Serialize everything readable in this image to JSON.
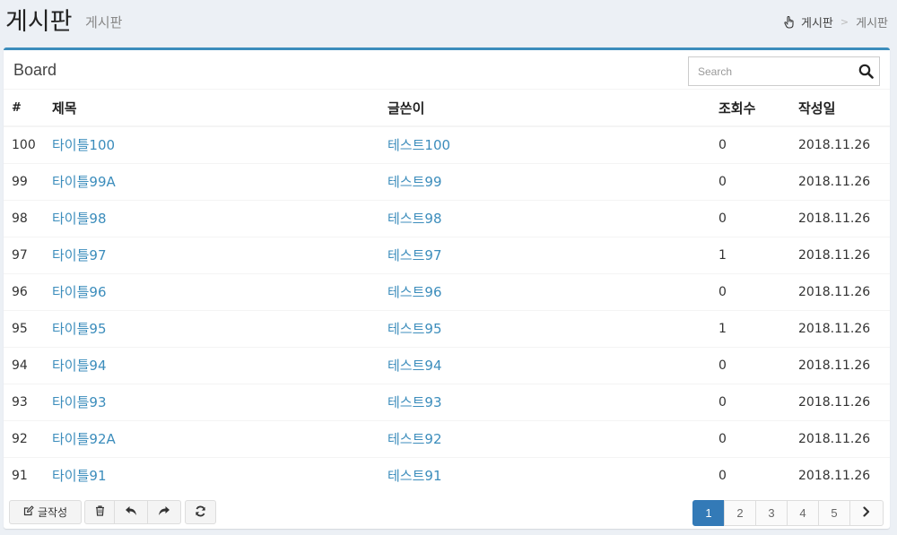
{
  "header": {
    "title": "게시판",
    "subtitle": "게시판",
    "breadcrumb": [
      "게시판",
      "게시판"
    ],
    "breadcrumb_separator": ">"
  },
  "box": {
    "title": "Board",
    "search_placeholder": "Search"
  },
  "table": {
    "headers": {
      "num": "#",
      "title": "제목",
      "writer": "글쓴이",
      "views": "조회수",
      "date": "작성일"
    },
    "rows": [
      {
        "num": "100",
        "title": "타이틀100",
        "writer": "테스트100",
        "views": "0",
        "date": "2018.11.26"
      },
      {
        "num": "99",
        "title": "타이틀99A",
        "writer": "테스트99",
        "views": "0",
        "date": "2018.11.26"
      },
      {
        "num": "98",
        "title": "타이틀98",
        "writer": "테스트98",
        "views": "0",
        "date": "2018.11.26"
      },
      {
        "num": "97",
        "title": "타이틀97",
        "writer": "테스트97",
        "views": "1",
        "date": "2018.11.26"
      },
      {
        "num": "96",
        "title": "타이틀96",
        "writer": "테스트96",
        "views": "0",
        "date": "2018.11.26"
      },
      {
        "num": "95",
        "title": "타이틀95",
        "writer": "테스트95",
        "views": "1",
        "date": "2018.11.26"
      },
      {
        "num": "94",
        "title": "타이틀94",
        "writer": "테스트94",
        "views": "0",
        "date": "2018.11.26"
      },
      {
        "num": "93",
        "title": "타이틀93",
        "writer": "테스트93",
        "views": "0",
        "date": "2018.11.26"
      },
      {
        "num": "92",
        "title": "타이틀92A",
        "writer": "테스트92",
        "views": "0",
        "date": "2018.11.26"
      },
      {
        "num": "91",
        "title": "타이틀91",
        "writer": "테스트91",
        "views": "0",
        "date": "2018.11.26"
      }
    ]
  },
  "footer": {
    "write_label": "글작성",
    "pages": [
      "1",
      "2",
      "3",
      "4",
      "5"
    ],
    "active_page": "1"
  },
  "colors": {
    "accent": "#3c8dbc",
    "active_page": "#337ab7",
    "background": "#ecf0f5"
  },
  "icons": {
    "breadcrumb": "hand-pointer-icon",
    "search": "search-icon",
    "write": "edit-icon",
    "delete": "trash-icon",
    "reply": "reply-icon",
    "forward": "forward-icon",
    "refresh": "refresh-icon",
    "next": "chevron-right-icon"
  }
}
